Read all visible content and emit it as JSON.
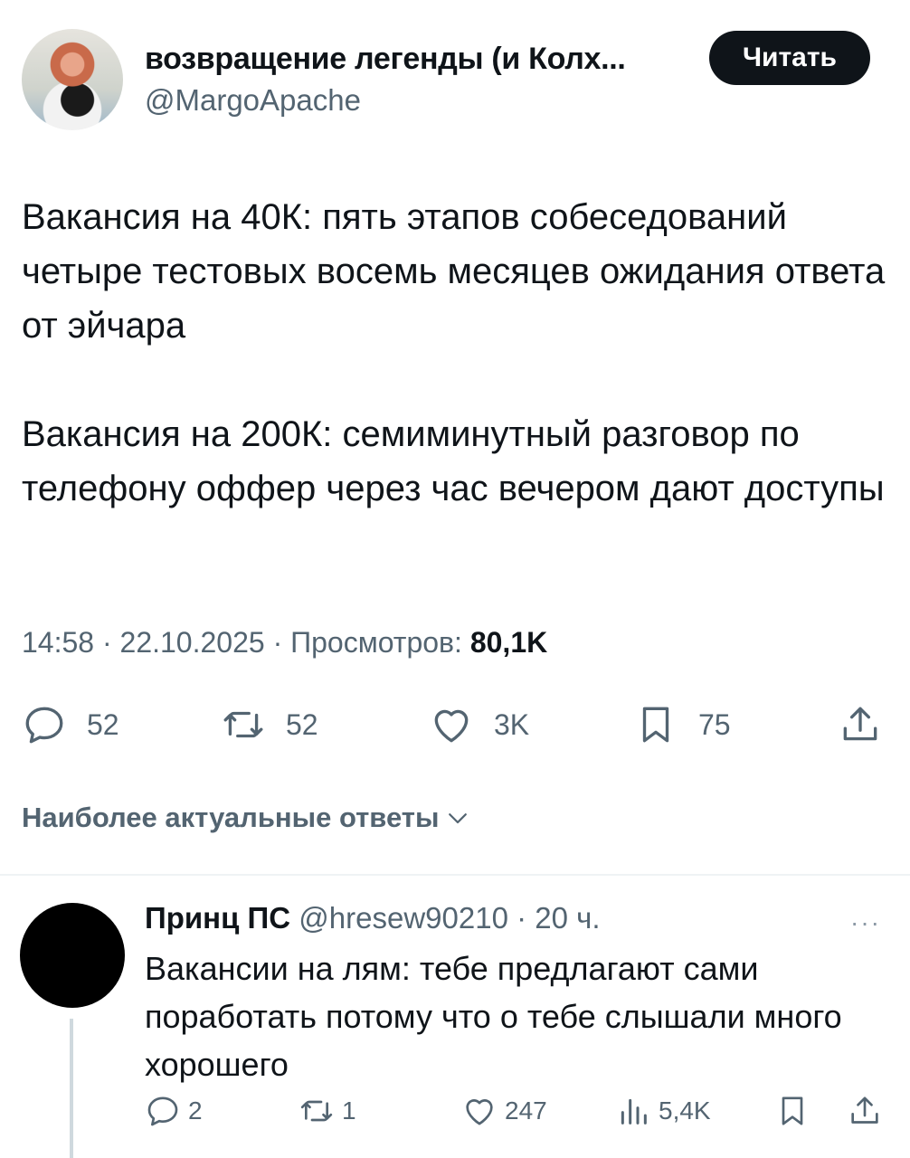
{
  "header": {
    "display_name": "возвращение легенды (и Колх...",
    "handle": "@MargoApache",
    "follow_label": "Читать"
  },
  "tweet": {
    "text": "Вакансия на 40К: пять этапов собеседований четыре тестовых восемь месяцев ожидания ответа от эйчара\n\nВакансия на 200К: семиминутный разговор по телефону оффер через час вечером дают доступы",
    "meta_prefix": "14:58 · 22.10.2025 · Просмотров: ",
    "views": "80,1K"
  },
  "actions": {
    "replies": "52",
    "retweets": "52",
    "likes": "3K",
    "bookmarks": "75"
  },
  "replies_filter": {
    "label": "Наиболее актуальные ответы"
  },
  "reply": {
    "name": "Принц ПС",
    "handle_time": " @hresew90210 · 20 ч.",
    "more": "···",
    "text": "Вакансии на лям: тебе предлагают сами поработать потому что о тебе слышали много хорошего",
    "actions": {
      "replies": "2",
      "retweets": "1",
      "likes": "247",
      "views": "5,4K"
    }
  },
  "icons": {
    "reply": "comment-icon",
    "retweet": "retweet-icon",
    "like": "heart-icon",
    "bookmark": "bookmark-icon",
    "share": "share-icon",
    "views": "bar-chart-icon",
    "chevron": "chevron-down-icon"
  },
  "colors": {
    "text": "#0f1419",
    "secondary": "#536471",
    "button_bg": "#0f1419",
    "divider": "#eff3f4"
  }
}
